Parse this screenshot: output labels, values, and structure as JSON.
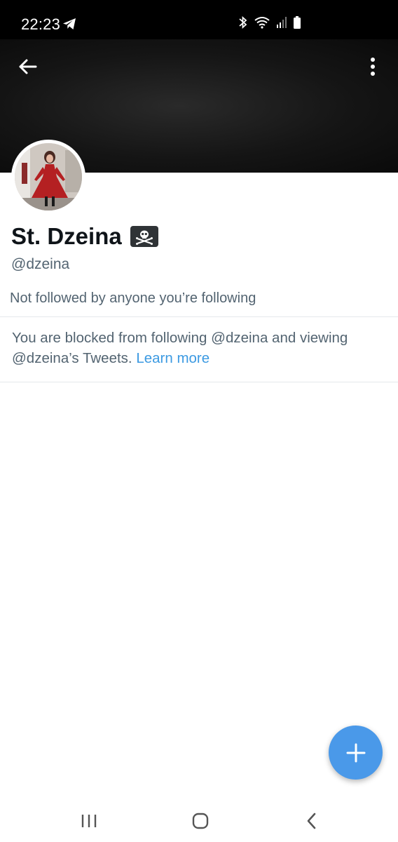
{
  "status_bar": {
    "time": "22:23",
    "icons": [
      "telegram-icon",
      "bluetooth-icon",
      "wifi-icon",
      "signal-icon",
      "battery-icon"
    ]
  },
  "header": {
    "back_icon": "arrow-left-icon",
    "more_icon": "more-vertical-icon"
  },
  "profile": {
    "display_name": "St. Dzeina",
    "name_emoji": "pirate-flag",
    "handle": "@dzeina",
    "followed_by": "Not followed by anyone you’re following"
  },
  "blocked_notice": {
    "text": "You are blocked from following @dzeina and viewing @dzeina’s Tweets.",
    "link": "Learn more"
  },
  "fab": {
    "icon": "plus-icon"
  },
  "nav_bar": {
    "icons": [
      "recent-apps-icon",
      "home-icon",
      "back-icon"
    ]
  },
  "colors": {
    "link": "#3c9ae2",
    "fab": "#4a99e9",
    "secondary_text": "#536471",
    "primary_text": "#0f1419"
  }
}
